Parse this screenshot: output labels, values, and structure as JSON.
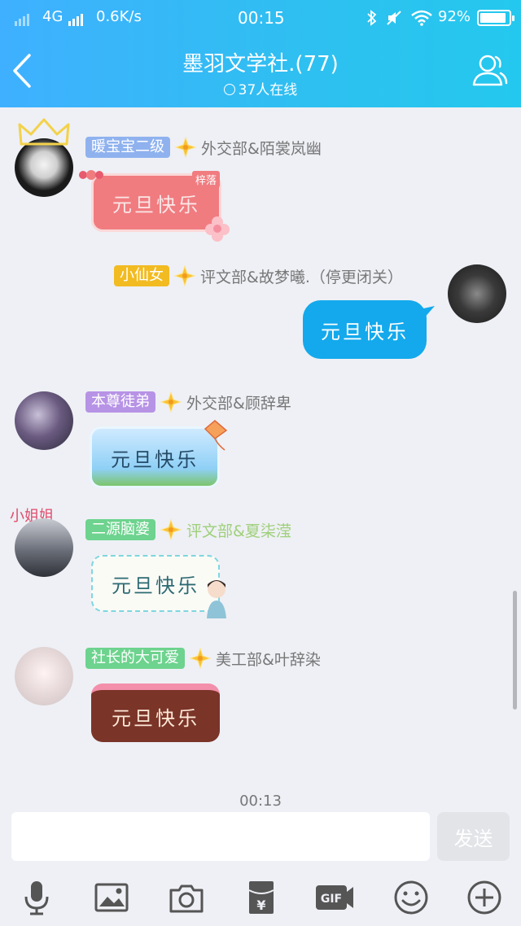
{
  "status_bar": {
    "network": "4G",
    "speed": "0.6K/s",
    "time": "00:15",
    "battery": "92%",
    "battery_level": 0.92
  },
  "header": {
    "title": "墨羽文学社.(77)",
    "online": "37人在线"
  },
  "messages": [
    {
      "name": "暖宝宝二级",
      "name_color": "#8fb2ef",
      "department": "外交部&陌裳岚幽",
      "text": "元旦快乐",
      "tag": "梓落"
    },
    {
      "name": "小仙女",
      "name_color": "#f2bb21",
      "department": "评文部&故梦曦.（停更闭关）",
      "text": "元旦快乐"
    },
    {
      "name": "本尊徒弟",
      "name_color": "#b793e6",
      "department": "外交部&顾辞卑",
      "text": "元旦快乐"
    },
    {
      "name": "二源脑婆",
      "name_color": "#6dd38e",
      "department": "评文部&夏柒滢",
      "text": "元旦快乐"
    },
    {
      "name": "社长的大可爱",
      "name_color": "#6dd38e",
      "department": "美工部&叶辞染",
      "text": "元旦快乐"
    }
  ],
  "avatar_caption": "小姐姐",
  "timestamp": "00:13",
  "composer": {
    "send_label": "发送",
    "gif_label": "GIF",
    "input_value": ""
  },
  "colors": {
    "header_start": "#3fb0ff",
    "header_end": "#24c8ee",
    "own_bubble": "#13a9ec",
    "background": "#eef0f5"
  },
  "icons": [
    "back-icon",
    "online-icon",
    "group-members-icon",
    "microphone-icon",
    "image-icon",
    "camera-icon",
    "red-envelope-icon",
    "gif-icon",
    "emoji-icon",
    "plus-icon"
  ]
}
